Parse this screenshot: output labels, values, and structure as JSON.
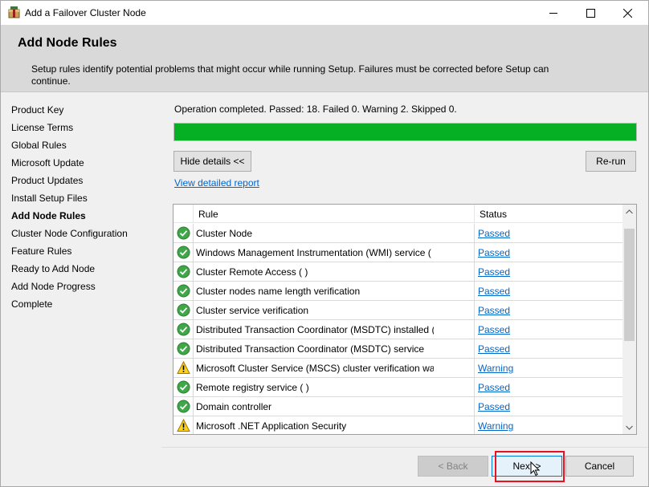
{
  "window": {
    "title": "Add a Failover Cluster Node",
    "controls": {
      "minimize": "minimize-icon",
      "maximize": "maximize-icon",
      "close": "close-icon"
    }
  },
  "header": {
    "title": "Add Node Rules",
    "description": "Setup rules identify potential problems that might occur while running Setup. Failures must be corrected before Setup can continue."
  },
  "nav": {
    "items": [
      {
        "label": "Product Key",
        "active": false
      },
      {
        "label": "License Terms",
        "active": false
      },
      {
        "label": "Global Rules",
        "active": false
      },
      {
        "label": "Microsoft Update",
        "active": false
      },
      {
        "label": "Product Updates",
        "active": false
      },
      {
        "label": "Install Setup Files",
        "active": false
      },
      {
        "label": "Add Node Rules",
        "active": true
      },
      {
        "label": "Cluster Node Configuration",
        "active": false
      },
      {
        "label": "Feature Rules",
        "active": false
      },
      {
        "label": "Ready to Add Node",
        "active": false
      },
      {
        "label": "Add Node Progress",
        "active": false
      },
      {
        "label": "Complete",
        "active": false
      }
    ]
  },
  "main": {
    "operation_status": "Operation completed. Passed: 18.   Failed 0.   Warning 2.   Skipped 0.",
    "progress_percent": 100,
    "progress_color": "#06b025",
    "hide_details_label": "Hide details <<",
    "rerun_label": "Re-run",
    "view_report_label": "View detailed report",
    "table": {
      "columns": [
        "Rule",
        "Status"
      ],
      "rows": [
        {
          "icon": "check-circle-icon",
          "rule": "Cluster Node",
          "status": "Passed"
        },
        {
          "icon": "check-circle-icon",
          "rule": "Windows Management Instrumentation (WMI) service (",
          "status": "Passed"
        },
        {
          "icon": "check-circle-icon",
          "rule": "Cluster Remote Access (                    )",
          "status": "Passed"
        },
        {
          "icon": "check-circle-icon",
          "rule": "Cluster nodes name length verification",
          "status": "Passed"
        },
        {
          "icon": "check-circle-icon",
          "rule": "Cluster service verification",
          "status": "Passed"
        },
        {
          "icon": "check-circle-icon",
          "rule": "Distributed Transaction Coordinator (MSDTC) installed (",
          "status": "Passed"
        },
        {
          "icon": "check-circle-icon",
          "rule": "Distributed Transaction Coordinator (MSDTC) service",
          "status": "Passed"
        },
        {
          "icon": "warning-icon",
          "rule": "Microsoft Cluster Service (MSCS) cluster verification warnings",
          "status": "Warning"
        },
        {
          "icon": "check-circle-icon",
          "rule": "Remote registry service (                    )",
          "status": "Passed"
        },
        {
          "icon": "check-circle-icon",
          "rule": "Domain controller",
          "status": "Passed"
        },
        {
          "icon": "warning-icon",
          "rule": "Microsoft .NET Application Security",
          "status": "Warning"
        }
      ]
    }
  },
  "footer": {
    "back_label": "< Back",
    "next_label": "Next >",
    "cancel_label": "Cancel"
  }
}
